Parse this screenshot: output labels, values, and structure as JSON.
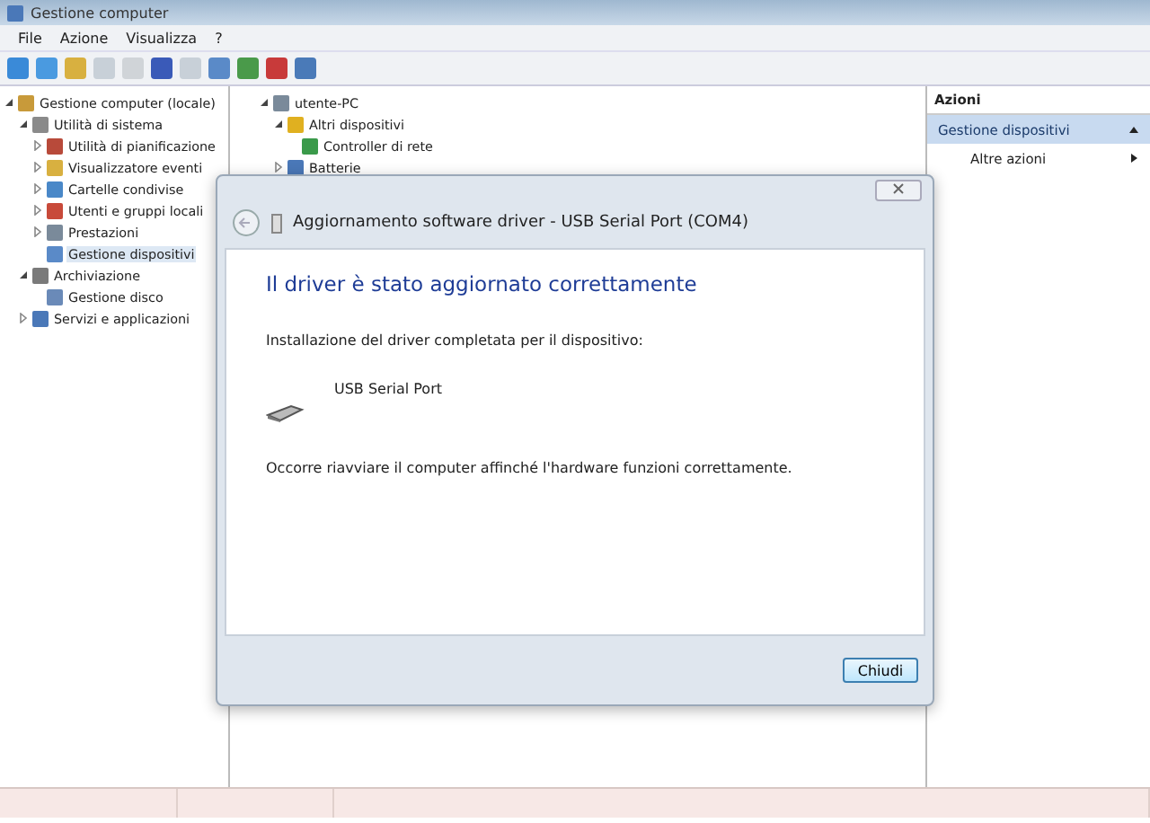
{
  "window": {
    "title": "Gestione computer"
  },
  "menu": [
    "File",
    "Azione",
    "Visualizza",
    "?"
  ],
  "sidebar": {
    "items": [
      {
        "label": "Gestione computer (locale)",
        "expanded": true,
        "selected": false,
        "children": [
          {
            "label": "Utilità di sistema",
            "expanded": true,
            "selected": false,
            "children": [
              {
                "label": "Utilità di pianificazione",
                "expanded": false,
                "selected": false
              },
              {
                "label": "Visualizzatore eventi",
                "expanded": false,
                "selected": false
              },
              {
                "label": "Cartelle condivise",
                "expanded": false,
                "selected": false
              },
              {
                "label": "Utenti e gruppi locali",
                "expanded": false,
                "selected": false
              },
              {
                "label": "Prestazioni",
                "expanded": false,
                "selected": false
              },
              {
                "label": "Gestione dispositivi",
                "selected": true
              }
            ]
          },
          {
            "label": "Archiviazione",
            "expanded": true,
            "selected": false,
            "children": [
              {
                "label": "Gestione disco",
                "selected": false
              }
            ]
          },
          {
            "label": "Servizi e applicazioni",
            "expanded": false,
            "selected": false
          }
        ]
      }
    ]
  },
  "devices": {
    "items": [
      {
        "label": "utente-PC",
        "expanded": true,
        "children": [
          {
            "label": "Altri dispositivi",
            "expanded": true,
            "children": [
              {
                "label": "Controller di rete"
              }
            ]
          },
          {
            "label": "Batterie",
            "expanded": false
          }
        ]
      }
    ]
  },
  "actions": {
    "title": "Azioni",
    "items": [
      {
        "label": "Gestione dispositivi",
        "kind": "header"
      },
      {
        "label": "Altre azioni",
        "kind": "submenu"
      }
    ]
  },
  "dialog": {
    "title": "Aggiornamento software driver - USB Serial Port (COM4)",
    "heading": "Il driver è stato aggiornato correttamente",
    "intro": "Installazione del driver completata per il dispositivo:",
    "device": "USB Serial Port",
    "note": "Occorre riavviare il computer affinché l'hardware funzioni correttamente.",
    "button": "Chiudi"
  }
}
